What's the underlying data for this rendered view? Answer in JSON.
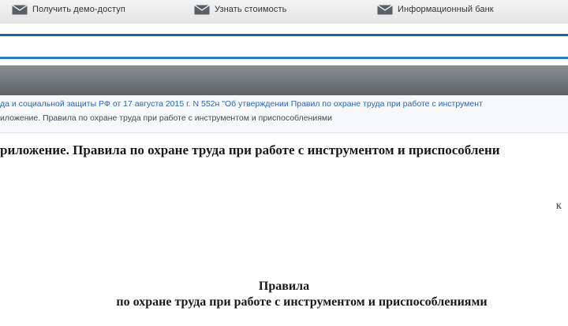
{
  "topnav": {
    "links": [
      {
        "label": "Получить демо-доступ",
        "icon": "envelope-icon"
      },
      {
        "label": "Узнать стоимость",
        "icon": "envelope-icon"
      },
      {
        "label": "Информационный банк",
        "icon": "envelope-icon"
      }
    ]
  },
  "breadcrumbs": {
    "line1": "да и социальной защиты РФ от 17 августа 2015 г. N 552н \"Об утверждении Правил по охране труда при работе с инструмент",
    "line2": "иложение. Правила по охране труда при работе с инструментом и приспособлениями"
  },
  "document": {
    "heading": "риложение. Правила по охране труда при работе с инструментом и приспособлени",
    "margin_mark": "к",
    "title_line1": "Правила",
    "title_line2": "по охране труда при работе с инструментом и приспособлениями"
  },
  "colors": {
    "accent_blue": "#2a7bc6",
    "link_blue": "#2f64b4",
    "band_grey": "#6e7276"
  }
}
